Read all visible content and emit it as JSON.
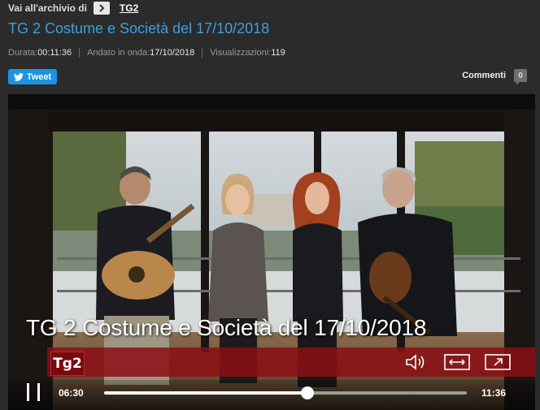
{
  "breadcrumb": {
    "prefix": "Vai all'archivio di",
    "link": "TG2"
  },
  "title": "TG 2 Costume e Società del 17/10/2018",
  "meta": {
    "duration_label": "Durata:",
    "duration": "00:11:36",
    "aired_label": "Andato in onda:",
    "aired": "17/10/2018",
    "views_label": "Visualizzazioni:",
    "views": "119"
  },
  "tweet_label": "Tweet",
  "comments": {
    "label": "Commenti",
    "count": "0"
  },
  "player": {
    "overlay_title": "TG 2 Costume e Società del 17/10/2018",
    "logo_text": "Tg2",
    "elapsed": "06:30",
    "total": "11:36",
    "progress": 0.56,
    "icons": [
      "pause-icon",
      "volume-icon",
      "resize-icon",
      "fullscreen-icon",
      "chevron-right-icon",
      "twitter-bird-icon"
    ]
  },
  "colors": {
    "link": "#3aa0dd",
    "tweet": "#1b95e0",
    "redbar": "#8c0e14"
  }
}
